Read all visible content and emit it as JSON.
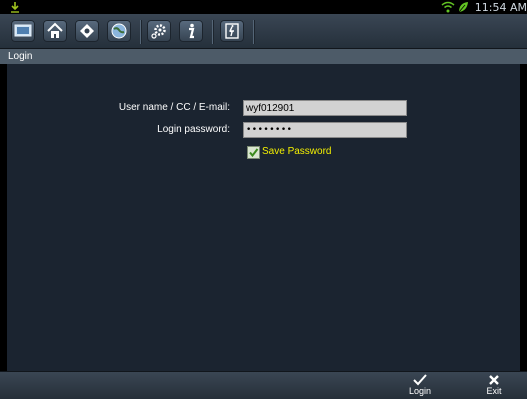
{
  "status_bar": {
    "time": "11:54 AM"
  },
  "toolbar": {
    "buttons": [
      "monitor-icon",
      "home-icon",
      "ptz-control-icon",
      "globe-icon",
      "settings-icon",
      "info-icon",
      "logout-icon"
    ]
  },
  "page": {
    "title": "Login"
  },
  "form": {
    "username_label": "User name / CC / E-mail:",
    "username_value": "wyf012901",
    "password_label": "Login password:",
    "password_value": "••••••••",
    "save_password_label": "Save Password",
    "save_password_checked": true
  },
  "bottom_bar": {
    "login_label": "Login",
    "exit_label": "Exit"
  },
  "colors": {
    "background": "#1b2430",
    "accent_label": "#f4f000"
  }
}
